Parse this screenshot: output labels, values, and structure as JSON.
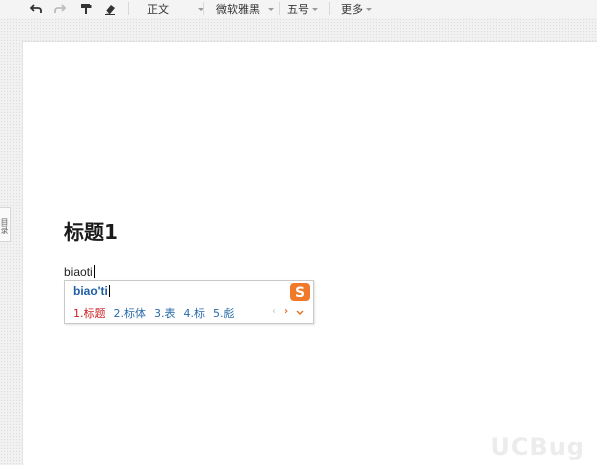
{
  "toolbar": {
    "undo_icon": "undo-icon",
    "redo_icon": "redo-icon",
    "format_painter_icon": "format-painter-icon",
    "eraser_icon": "eraser-icon",
    "style_dropdown": "正文",
    "font_dropdown": "微软雅黑",
    "size_dropdown": "五号",
    "more_dropdown": "更多"
  },
  "sidebar": {
    "outline_tab": "目录"
  },
  "document": {
    "heading": "标题1",
    "typed_text": "biaoti"
  },
  "ime": {
    "composition": "biao'ti",
    "logo": "S",
    "candidates": [
      {
        "label": "1.标题",
        "selected": true
      },
      {
        "label": "2.标体",
        "selected": false
      },
      {
        "label": "3.表",
        "selected": false
      },
      {
        "label": "4.标",
        "selected": false
      },
      {
        "label": "5.彪",
        "selected": false
      }
    ],
    "colors": {
      "selected": "#cc2222",
      "candidate": "#2a6aa8",
      "composition": "#1f5fa5",
      "logo": "#f07a2a"
    }
  },
  "watermark": "UCBug"
}
